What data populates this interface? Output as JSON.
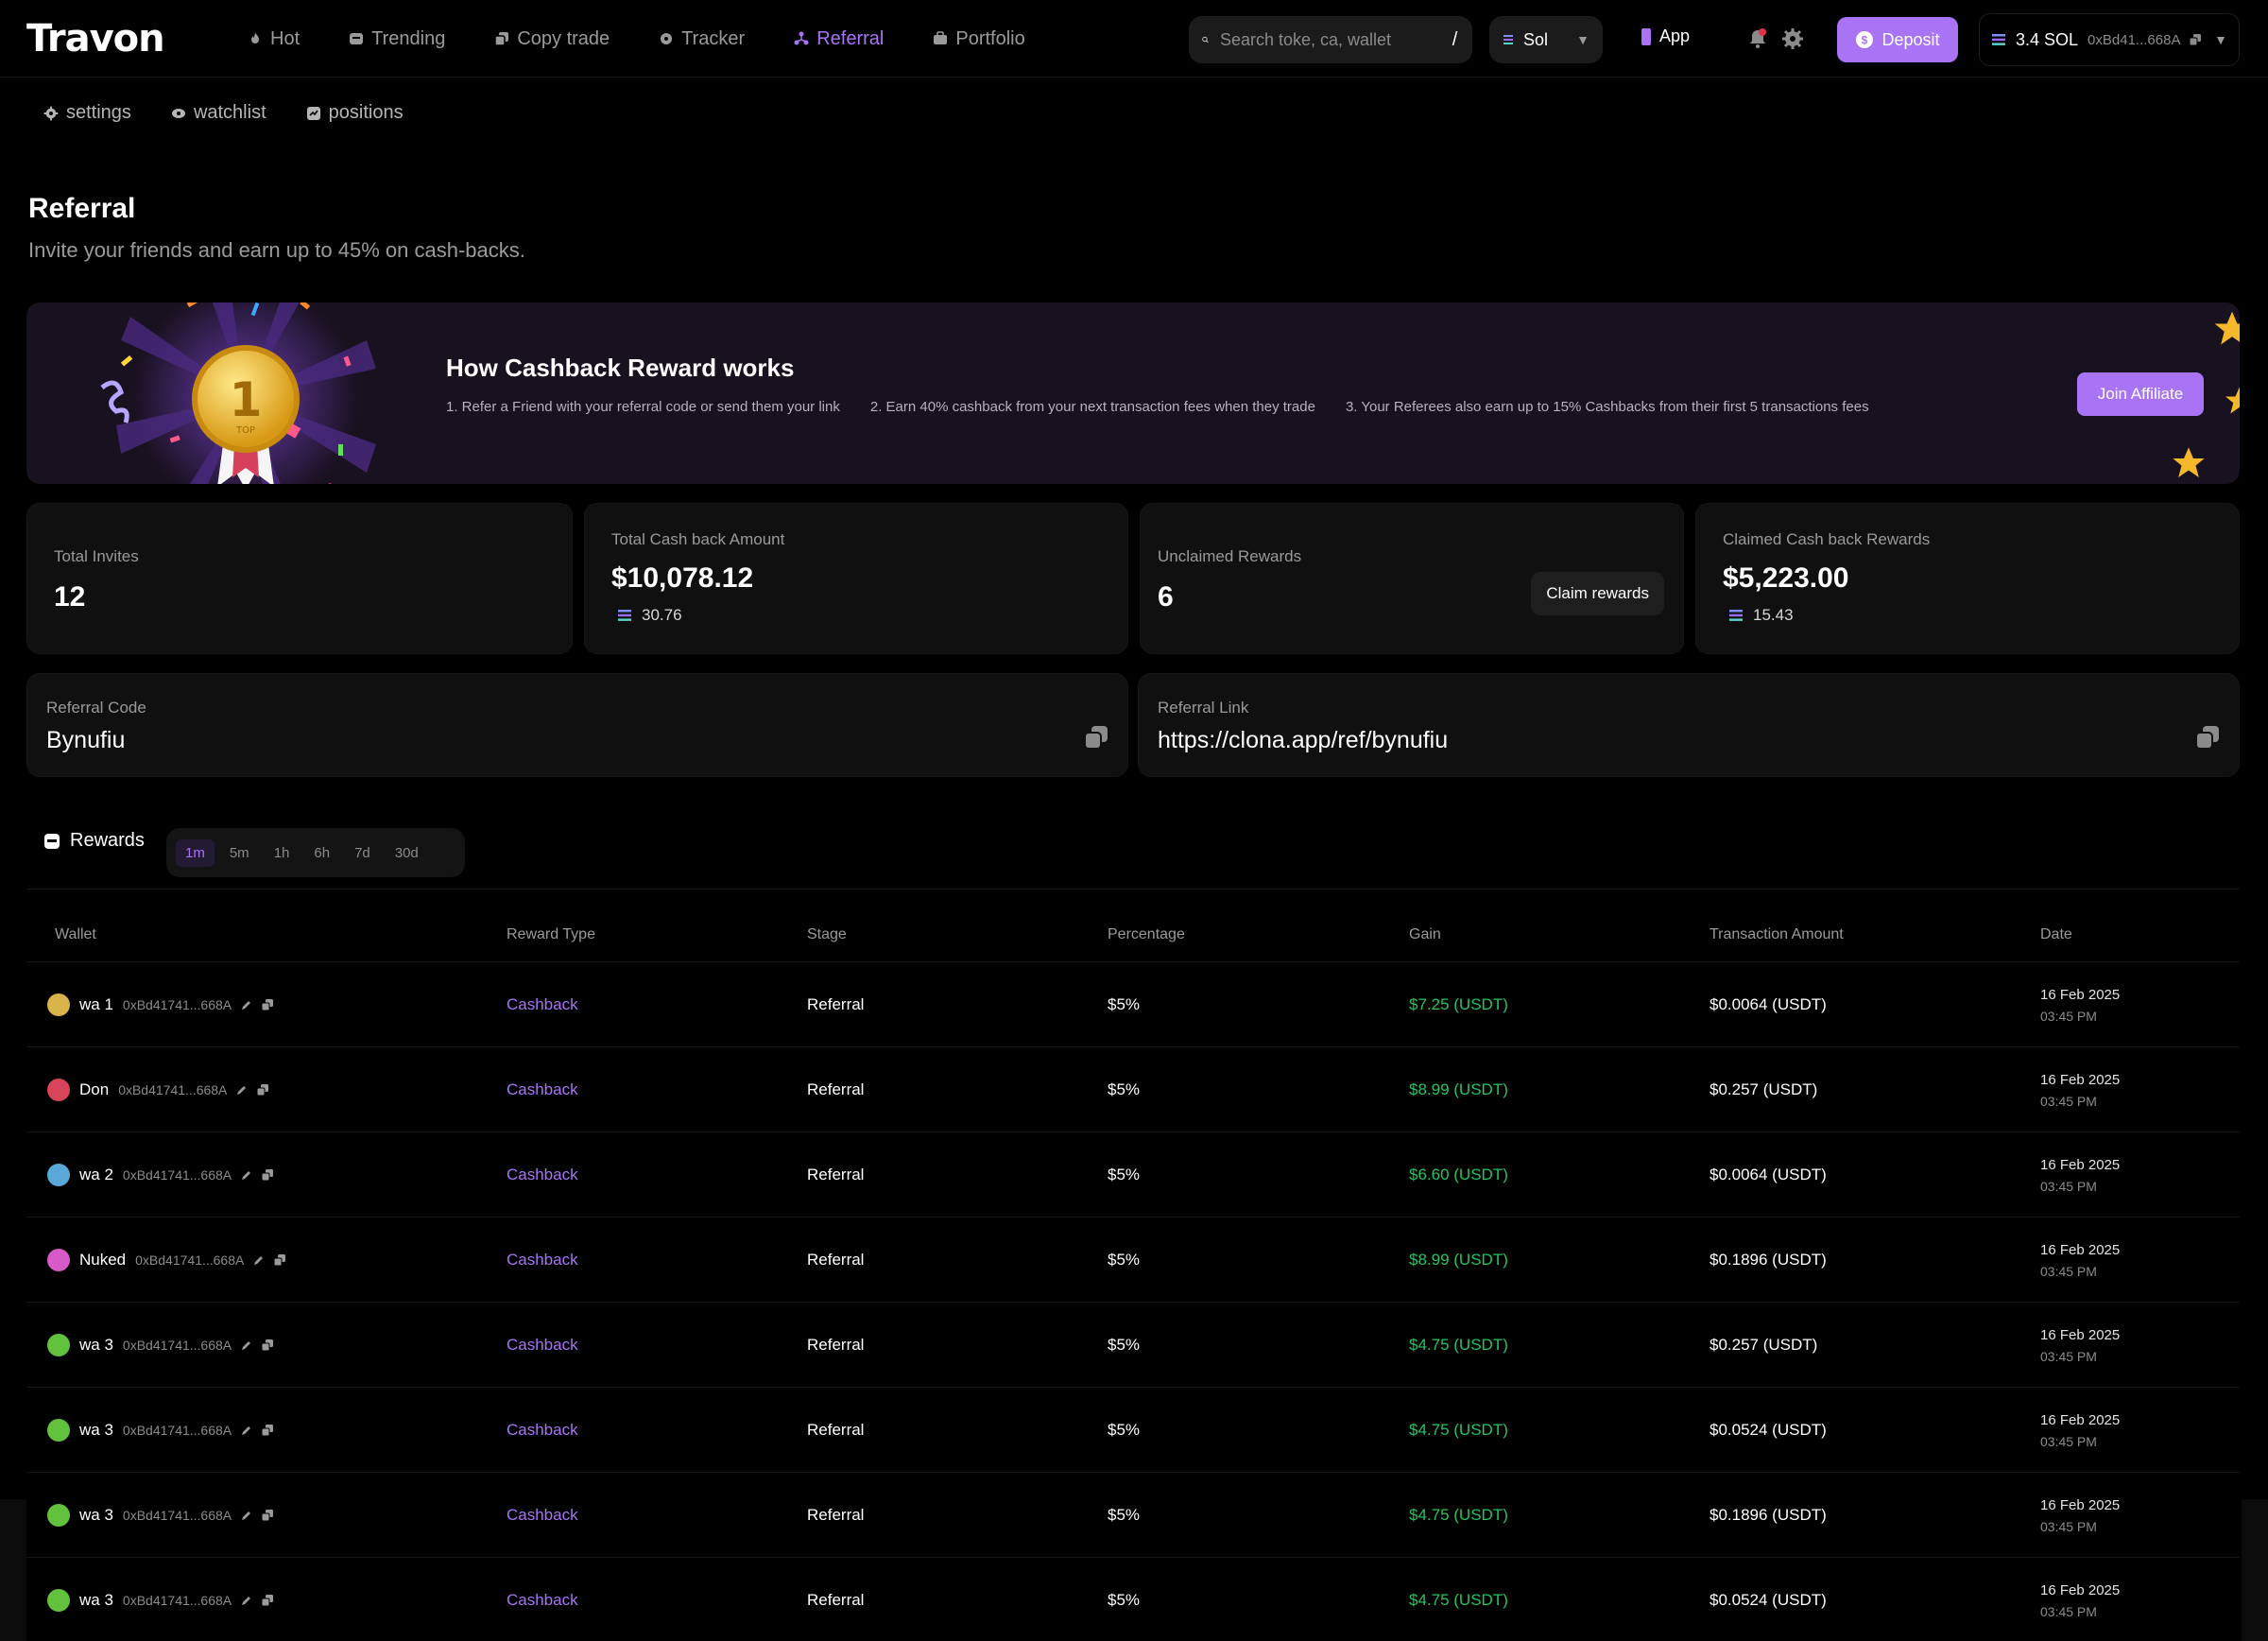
{
  "brand": {
    "logo": "Travon"
  },
  "nav": [
    {
      "label": "Hot",
      "icon": "flame-icon",
      "active": false
    },
    {
      "label": "Trending",
      "icon": "trending-icon",
      "active": false
    },
    {
      "label": "Copy trade",
      "icon": "copy-icon",
      "active": false
    },
    {
      "label": "Tracker",
      "icon": "tracker-icon",
      "active": false
    },
    {
      "label": "Referral",
      "icon": "referral-icon",
      "active": true
    },
    {
      "label": "Portfolio",
      "icon": "portfolio-icon",
      "active": false
    }
  ],
  "search": {
    "placeholder": "Search toke, ca, wallet",
    "shortcut": "/"
  },
  "chain": {
    "label": "Sol"
  },
  "app_link": "App",
  "deposit_label": "Deposit",
  "wallet": {
    "balance": "3.4 SOL",
    "address": "0xBd41...668A"
  },
  "subnav": [
    {
      "label": "settings",
      "icon": "gear-icon"
    },
    {
      "label": "watchlist",
      "icon": "eye-icon"
    },
    {
      "label": "positions",
      "icon": "positions-icon"
    }
  ],
  "page": {
    "title": "Referral",
    "subtitle": "Invite your friends and earn up to 45% on cash-backs."
  },
  "banner": {
    "title": "How Cashback Reward works",
    "medal_number": "1",
    "medal_text": "TOP",
    "steps": [
      "1. Refer a Friend with your referral code or send them your link",
      "2. Earn 40% cashback from your next transaction fees when they trade",
      "3. Your Referees also earn up to 15% Cashbacks from their first 5 transactions fees"
    ],
    "cta": "Join Affiliate"
  },
  "stats": {
    "total_invites": {
      "label": "Total Invites",
      "value": "12"
    },
    "total_cashback": {
      "label": "Total Cash back Amount",
      "value": "$10,078.12",
      "sol": "30.76"
    },
    "unclaimed": {
      "label": "Unclaimed Rewards",
      "value": "6",
      "button": "Claim rewards"
    },
    "claimed": {
      "label": "Claimed Cash back Rewards",
      "value": "$5,223.00",
      "sol": "15.43"
    }
  },
  "referral": {
    "code_label": "Referral Code",
    "code": "Bynufiu",
    "link_label": "Referral Link",
    "link": "https://clona.app/ref/bynufiu"
  },
  "rewards": {
    "title": "Rewards",
    "timeframes": [
      "1m",
      "5m",
      "1h",
      "6h",
      "7d",
      "30d"
    ],
    "active_timeframe": "1m",
    "columns": [
      "Wallet",
      "Reward Type",
      "Stage",
      "Percentage",
      "Gain",
      "Transaction Amount",
      "Date"
    ],
    "rows": [
      {
        "name": "wa 1",
        "addr": "0xBd41741...668A",
        "avatar": "#d8b44a",
        "type": "Cashback",
        "stage": "Referral",
        "pct": "$5%",
        "gain": "$7.25 (USDT)",
        "amount": "$0.0064 (USDT)",
        "date": "16 Feb 2025",
        "time": "03:45 PM"
      },
      {
        "name": "Don",
        "addr": "0xBd41741...668A",
        "avatar": "#d8445a",
        "type": "Cashback",
        "stage": "Referral",
        "pct": "$5%",
        "gain": "$8.99 (USDT)",
        "amount": "$0.257 (USDT)",
        "date": "16 Feb 2025",
        "time": "03:45 PM"
      },
      {
        "name": "wa 2",
        "addr": "0xBd41741...668A",
        "avatar": "#5aa8d8",
        "type": "Cashback",
        "stage": "Referral",
        "pct": "$5%",
        "gain": "$6.60 (USDT)",
        "amount": "$0.0064 (USDT)",
        "date": "16 Feb 2025",
        "time": "03:45 PM"
      },
      {
        "name": "Nuked",
        "addr": "0xBd41741...668A",
        "avatar": "#d85ac8",
        "type": "Cashback",
        "stage": "Referral",
        "pct": "$5%",
        "gain": "$8.99 (USDT)",
        "amount": "$0.1896 (USDT)",
        "date": "16 Feb 2025",
        "time": "03:45 PM"
      },
      {
        "name": "wa 3",
        "addr": "0xBd41741...668A",
        "avatar": "#62c23e",
        "type": "Cashback",
        "stage": "Referral",
        "pct": "$5%",
        "gain": "$4.75 (USDT)",
        "amount": "$0.257 (USDT)",
        "date": "16 Feb 2025",
        "time": "03:45 PM"
      },
      {
        "name": "wa 3",
        "addr": "0xBd41741...668A",
        "avatar": "#62c23e",
        "type": "Cashback",
        "stage": "Referral",
        "pct": "$5%",
        "gain": "$4.75 (USDT)",
        "amount": "$0.0524 (USDT)",
        "date": "16 Feb 2025",
        "time": "03:45 PM"
      },
      {
        "name": "wa 3",
        "addr": "0xBd41741...668A",
        "avatar": "#62c23e",
        "type": "Cashback",
        "stage": "Referral",
        "pct": "$5%",
        "gain": "$4.75 (USDT)",
        "amount": "$0.1896 (USDT)",
        "date": "16 Feb 2025",
        "time": "03:45 PM"
      },
      {
        "name": "wa 3",
        "addr": "0xBd41741...668A",
        "avatar": "#62c23e",
        "type": "Cashback",
        "stage": "Referral",
        "pct": "$5%",
        "gain": "$4.75 (USDT)",
        "amount": "$0.0524 (USDT)",
        "date": "16 Feb 2025",
        "time": "03:45 PM"
      }
    ]
  },
  "colors": {
    "accent": "#a874f5",
    "gain": "#23c463",
    "background": "#000000",
    "card": "#101010"
  }
}
